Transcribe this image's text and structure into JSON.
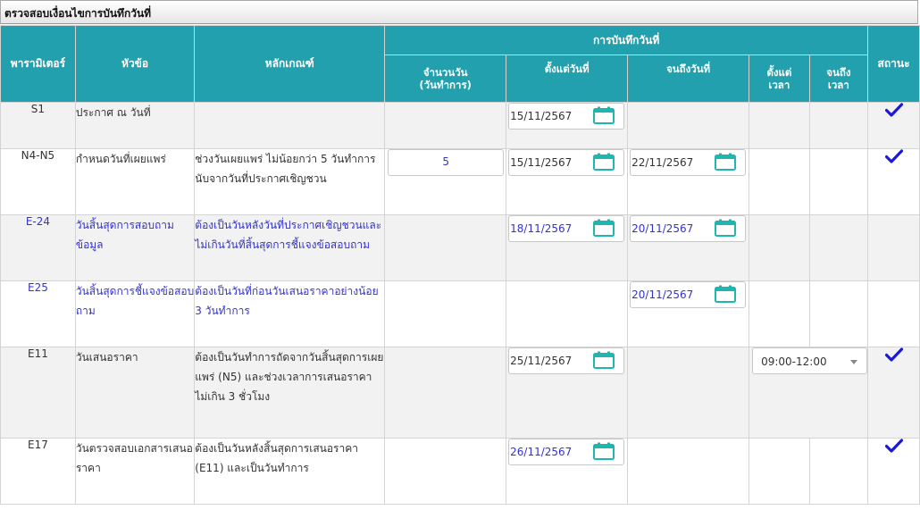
{
  "title": "ตรวจสอบเงื่อนไขการบันทึกวันที่",
  "colors": {
    "header_bg": "#23a0ad",
    "check": "#1a1ad6",
    "calendar": "#1fb6b0",
    "link_text": "#3333cc"
  },
  "header": {
    "param": "พารามิเตอร์",
    "topic": "หัวข้อ",
    "criteria": "หลักเกณฑ์",
    "group": "การบันทึกวันที่",
    "days_line1": "จำนวนวัน",
    "days_line2": "(วันทำการ)",
    "from_date": "ตั้งแต่วันที่",
    "to_date": "จนถึงวันที่",
    "from_time_line1": "ตั้งแต่",
    "from_time_line2": "เวลา",
    "to_time_line1": "จนถึง",
    "to_time_line2": "เวลา",
    "status": "สถานะ"
  },
  "rows": [
    {
      "code": "S1",
      "topic": "ประกาศ ณ วันที่",
      "criteria": "",
      "days": "",
      "from_date": "15/11/2567",
      "to_date": "",
      "from_time": "",
      "status": "check"
    },
    {
      "code": "N4-N5",
      "topic": "กำหนดวันที่เผยแพร่",
      "criteria": "ช่วงวันเผยแพร่ ไม่น้อยกว่า 5 วันทำการ นับจากวันที่ประกาศเชิญชวน",
      "days": "5",
      "from_date": "15/11/2567",
      "to_date": "22/11/2567",
      "from_time": "",
      "status": "check"
    },
    {
      "code": "E-24",
      "topic": "วันสิ้นสุดการสอบถามข้อมูล",
      "criteria": "ต้องเป็นวันหลังวันที่ประกาศเชิญชวนและไม่เกินวันที่สิ้นสุดการชี้แจงข้อสอบถาม",
      "days": "",
      "from_date": "18/11/2567",
      "to_date": "20/11/2567",
      "from_time": "",
      "status": ""
    },
    {
      "code": "E25",
      "topic": "วันสิ้นสุดการชี้แจงข้อสอบถาม",
      "criteria": "ต้องเป็นวันที่ก่อนวันเสนอราคาอย่างน้อย 3 วันทำการ",
      "days": "",
      "from_date": "",
      "to_date": "20/11/2567",
      "from_time": "",
      "status": ""
    },
    {
      "code": "E11",
      "topic": "วันเสนอราคา",
      "criteria": "ต้องเป็นวันทำการถัดจากวันสิ้นสุดการเผยแพร่ (N5) และช่วงเวลาการเสนอราคาไม่เกิน 3 ชั่วโมง",
      "days": "",
      "from_date": "25/11/2567",
      "to_date": "",
      "from_time": "09:00-12:00",
      "status": "check"
    },
    {
      "code": "E17",
      "topic": "วันตรวจสอบเอกสารเสนอราคา",
      "criteria": "ต้องเป็นวันหลังสิ้นสุดการเสนอราคา (E11) และเป็นวันทำการ",
      "days": "",
      "from_date": "26/11/2567",
      "to_date": "",
      "from_time": "",
      "status": "check"
    }
  ]
}
